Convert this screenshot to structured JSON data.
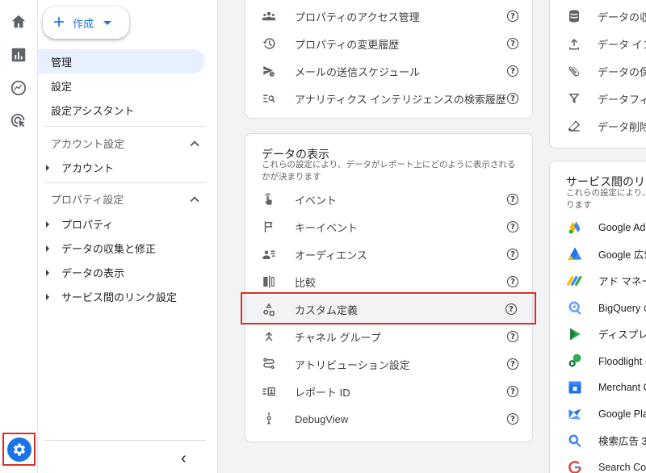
{
  "rail": {
    "icons": [
      "home-icon",
      "reports-icon",
      "explore-icon",
      "advertising-icon"
    ],
    "settings_icon": "gear-icon"
  },
  "nav": {
    "create_label": "作成",
    "items": [
      {
        "label": "管理",
        "active": true
      },
      {
        "label": "設定"
      },
      {
        "label": "設定アシスタント"
      }
    ],
    "account_section": {
      "title": "アカウント設定",
      "items": [
        "アカウント"
      ]
    },
    "property_section": {
      "title": "プロパティ設定",
      "items": [
        "プロパティ",
        "データの収集と修正",
        "データの表示",
        "サービス間のリンク設定"
      ]
    },
    "collapse_glyph": "‹"
  },
  "top_card": {
    "items": [
      {
        "label": "プロパティのアクセス管理",
        "icon": "people-icon"
      },
      {
        "label": "プロパティの変更履歴",
        "icon": "history-icon"
      },
      {
        "label": "メールの送信スケジュール",
        "icon": "scheduled-send-icon"
      },
      {
        "label": "アナリティクス インテリジェンスの検索履歴",
        "icon": "search-history-icon"
      }
    ]
  },
  "display_card": {
    "title": "データの表示",
    "desc_line1": "これらの設定により、データがレポート上にどのように表示される",
    "desc_line2": "かが決まります",
    "items": [
      {
        "label": "イベント",
        "icon": "touch-icon"
      },
      {
        "label": "キーイベント",
        "icon": "flag-icon"
      },
      {
        "label": "オーディエンス",
        "icon": "audience-icon"
      },
      {
        "label": "比較",
        "icon": "compare-icon"
      },
      {
        "label": "カスタム定義",
        "icon": "shapes-icon",
        "highlighted": true
      },
      {
        "label": "チャネル グループ",
        "icon": "merge-icon"
      },
      {
        "label": "アトリビューション設定",
        "icon": "route-icon"
      },
      {
        "label": "レポート ID",
        "icon": "report-id-icon"
      },
      {
        "label": "DebugView",
        "icon": "debug-icon"
      }
    ]
  },
  "right_top_card": {
    "items": [
      {
        "label": "データの収",
        "icon": "database-icon"
      },
      {
        "label": "データ イン",
        "icon": "upload-icon"
      },
      {
        "label": "データの保",
        "icon": "attach-icon"
      },
      {
        "label": "データフィ",
        "icon": "filter-icon"
      },
      {
        "label": "データ削除",
        "icon": "eraser-icon"
      }
    ]
  },
  "services_card": {
    "title": "サービス間のリン",
    "desc_line1": "これらの設定により、",
    "desc_line2": "ります",
    "items": [
      {
        "label": "Google Ad",
        "icon": "google-ads-icon"
      },
      {
        "label": "Google 広告",
        "icon": "google-ad-manager-icon"
      },
      {
        "label": "アド マネー",
        "icon": "ad-manager-icon"
      },
      {
        "label": "BigQuery の",
        "icon": "bigquery-icon"
      },
      {
        "label": "ディスプレ",
        "icon": "display-video-icon"
      },
      {
        "label": "Floodlight の",
        "icon": "floodlight-icon"
      },
      {
        "label": "Merchant C",
        "icon": "merchant-center-icon"
      },
      {
        "label": "Google Pla",
        "icon": "google-play-icon"
      },
      {
        "label": "検索広告 36",
        "icon": "search-ads-icon"
      },
      {
        "label": "Search Co",
        "icon": "search-console-icon"
      }
    ]
  },
  "colors": {
    "accent": "#1a73e8",
    "highlight_border": "#d93025",
    "active_nav_bg": "#e8f0fe"
  }
}
